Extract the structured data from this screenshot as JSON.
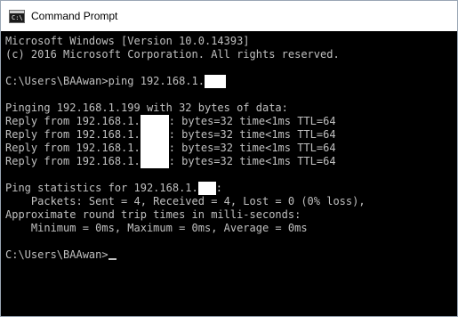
{
  "window": {
    "title": "Command Prompt",
    "icon": "cmd-icon",
    "icon_text": "C:\\",
    "colors": {
      "background": "#000000",
      "text": "#c0c0c0",
      "titlebar": "#ffffff"
    }
  },
  "console": {
    "lines": [
      {
        "pre": "Microsoft Windows [Version 10.0.14393]"
      },
      {
        "pre": "(c) 2016 Microsoft Corporation. All rights reserved."
      },
      {
        "blank": true
      },
      {
        "pre": "C:\\Users\\BAAwan>ping 192.168.1.",
        "redacted": "trailing"
      },
      {
        "blank": true
      },
      {
        "pre": "Pinging 192.168.1.199 with 32 bytes of data:"
      },
      {
        "pre": "Reply from 192.168.1.",
        "redacted": "middle",
        "post": ": bytes=32 time<1ms TTL=64"
      },
      {
        "pre": "Reply from 192.168.1.",
        "redacted": "middle",
        "post": ": bytes=32 time<1ms TTL=64"
      },
      {
        "pre": "Reply from 192.168.1.",
        "redacted": "middle",
        "post": ": bytes=32 time<1ms TTL=64"
      },
      {
        "pre": "Reply from 192.168.1.",
        "redacted": "middle",
        "post": ": bytes=32 time<1ms TTL=64"
      },
      {
        "blank": true
      },
      {
        "pre": "Ping statistics for 192.168.1.",
        "redacted": "middle-short",
        "post": ":"
      },
      {
        "pre": "    Packets: Sent = 4, Received = 4, Lost = 0 (0% loss),"
      },
      {
        "pre": "Approximate round trip times in milli-seconds:"
      },
      {
        "pre": "    Minimum = 0ms, Maximum = 0ms, Average = 0ms"
      },
      {
        "blank": true
      },
      {
        "pre": "C:\\Users\\BAAwan>",
        "cursor": true
      }
    ]
  }
}
